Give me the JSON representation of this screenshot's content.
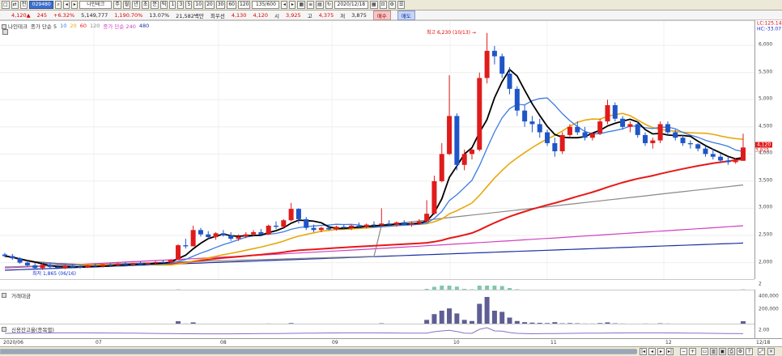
{
  "toolbar": {
    "buttons": [
      "□",
      "⇄"
    ],
    "market_select": "전",
    "code": "029480",
    "name": "나인테크",
    "period_buttons": [
      "주",
      "월",
      "년",
      "초",
      "분",
      "틱"
    ],
    "minute_buttons": [
      "1",
      "3",
      "5",
      "10",
      "20",
      "30",
      "60",
      "120"
    ],
    "count_value": "135/600",
    "date": "2020/12/18"
  },
  "info": {
    "price": "4,120",
    "price_arrow": "▲",
    "change": "245",
    "change_pct": "+6.32%",
    "volume": "5,149,777",
    "volume_ratio": "1,190.70%",
    "turnover": "13.07%",
    "amount": "21,582백만",
    "prev_label": "최우선",
    "bid": "4,130",
    "ask": "4,120",
    "open_label": "시",
    "open": "3,925",
    "high_label": "고",
    "high": "4,375",
    "low_label": "저",
    "low": "3,875",
    "buy_label": "매수",
    "sell_label": "매도"
  },
  "price_panel": {
    "legend": [
      {
        "label": "나인테크",
        "color": "#333333"
      },
      {
        "label": "종가 단순 5",
        "color": "#333333"
      },
      {
        "label": "10",
        "color": "#3a7be0"
      },
      {
        "label": "20",
        "color": "#e8a80c"
      },
      {
        "label": "60",
        "color": "#e81818"
      },
      {
        "label": "120",
        "color": "#888888"
      },
      {
        "label": "종가 단순 240",
        "color": "#d040c0"
      },
      {
        "label": "480",
        "color": "#1a2fa0"
      }
    ],
    "top_right": {
      "lc": "LC:125.14",
      "hc": "HC:-33.07"
    },
    "high_annotation": "최고 6,230 (10/13) →",
    "low_annotation": "최저 1,865 (06/16)",
    "last_price_tag": "4,120",
    "last_price_tag2": "3,925",
    "y_ticks": [
      "6,000",
      "5,500",
      "5,000",
      "4,500",
      "4,000",
      "3,500",
      "3,000",
      "2,500",
      "2,000"
    ],
    "bottom_right": "2"
  },
  "volume_panel": {
    "label": "거래대금",
    "y_ticks": [
      "400,000",
      "200,000"
    ]
  },
  "credit_panel": {
    "label": "신용잔고율(종목별)",
    "y_ticks": [
      "2.00"
    ]
  },
  "x_axis": {
    "labels": [
      "2020/06",
      "07",
      "08",
      "09",
      "10",
      "11",
      "12",
      "12/18"
    ]
  },
  "colors": {
    "up": "#e01b1b",
    "down": "#1f55c8",
    "ma5": "#000000",
    "ma10": "#3a7be0",
    "ma20": "#e8a80c",
    "ma60": "#e81818",
    "ma120": "#888888",
    "ma240": "#d040c0",
    "ma480": "#1a2fa0",
    "bar": "#5e5e94",
    "credit": "#8a6fc6"
  },
  "chart_data": {
    "type": "candlestick",
    "title": "나인테크",
    "x_range": [
      "2020/06",
      "2020/12/18"
    ],
    "ylim": [
      1800,
      6300
    ],
    "y_ticks": [
      2000,
      2500,
      3000,
      3500,
      4000,
      4500,
      5000,
      5500,
      6000
    ],
    "candles_ohlc": [
      [
        2150,
        2180,
        2100,
        2120
      ],
      [
        2120,
        2160,
        2050,
        2080
      ],
      [
        2080,
        2100,
        1980,
        2000
      ],
      [
        2000,
        2050,
        1920,
        1950
      ],
      [
        1950,
        2000,
        1880,
        1900
      ],
      [
        1900,
        1990,
        1865,
        1960
      ],
      [
        1960,
        1990,
        1900,
        1920
      ],
      [
        1920,
        1960,
        1880,
        1900
      ],
      [
        1900,
        1960,
        1880,
        1940
      ],
      [
        1940,
        1970,
        1900,
        1920
      ],
      [
        1920,
        1950,
        1890,
        1910
      ],
      [
        1910,
        1960,
        1900,
        1950
      ],
      [
        1950,
        1980,
        1920,
        1930
      ],
      [
        1930,
        1970,
        1910,
        1960
      ],
      [
        1960,
        1990,
        1930,
        1950
      ],
      [
        1950,
        1990,
        1940,
        1980
      ],
      [
        1980,
        2010,
        1950,
        1960
      ],
      [
        1960,
        2000,
        1940,
        1990
      ],
      [
        1990,
        2020,
        1960,
        1970
      ],
      [
        1970,
        2000,
        1950,
        1990
      ],
      [
        1990,
        2030,
        1970,
        2010
      ],
      [
        2010,
        2040,
        1990,
        2000
      ],
      [
        2000,
        2060,
        1990,
        2050
      ],
      [
        2050,
        2340,
        2050,
        2320
      ],
      [
        2320,
        2440,
        2260,
        2300
      ],
      [
        2300,
        2680,
        2300,
        2600
      ],
      [
        2600,
        2640,
        2480,
        2520
      ],
      [
        2520,
        2580,
        2440,
        2470
      ],
      [
        2470,
        2560,
        2420,
        2540
      ],
      [
        2540,
        2600,
        2480,
        2500
      ],
      [
        2500,
        2560,
        2400,
        2440
      ],
      [
        2440,
        2520,
        2400,
        2480
      ],
      [
        2480,
        2560,
        2450,
        2520
      ],
      [
        2520,
        2600,
        2480,
        2560
      ],
      [
        2560,
        2620,
        2500,
        2520
      ],
      [
        2520,
        2700,
        2510,
        2680
      ],
      [
        2680,
        2760,
        2620,
        2660
      ],
      [
        2660,
        2800,
        2640,
        2780
      ],
      [
        2780,
        3100,
        2760,
        2990
      ],
      [
        2990,
        3000,
        2720,
        2800
      ],
      [
        2800,
        2840,
        2600,
        2640
      ],
      [
        2640,
        2700,
        2560,
        2600
      ],
      [
        2600,
        2660,
        2560,
        2640
      ],
      [
        2640,
        2700,
        2600,
        2610
      ],
      [
        2610,
        2680,
        2590,
        2660
      ],
      [
        2660,
        2700,
        2620,
        2640
      ],
      [
        2640,
        2700,
        2600,
        2680
      ],
      [
        2680,
        2740,
        2640,
        2660
      ],
      [
        2660,
        2720,
        2630,
        2700
      ],
      [
        2700,
        2760,
        2660,
        2690
      ],
      [
        2690,
        3000,
        2670,
        2720
      ],
      [
        2720,
        2780,
        2680,
        2700
      ],
      [
        2700,
        2760,
        2660,
        2740
      ],
      [
        2740,
        2780,
        2690,
        2700
      ],
      [
        2700,
        2760,
        2660,
        2720
      ],
      [
        2720,
        2800,
        2700,
        2760
      ],
      [
        2760,
        3150,
        2740,
        2900
      ],
      [
        2900,
        3600,
        2880,
        3500
      ],
      [
        3500,
        4200,
        3480,
        4000
      ],
      [
        4000,
        5450,
        3980,
        4700
      ],
      [
        4700,
        4750,
        3700,
        3800
      ],
      [
        3800,
        4080,
        3700,
        4000
      ],
      [
        4000,
        4100,
        3900,
        4080
      ],
      [
        4080,
        5500,
        4050,
        5400
      ],
      [
        5400,
        6230,
        5300,
        5900
      ],
      [
        5900,
        5990,
        5650,
        5800
      ],
      [
        5800,
        5850,
        5400,
        5480
      ],
      [
        5480,
        5600,
        5100,
        5200
      ],
      [
        5200,
        5250,
        4700,
        4800
      ],
      [
        4800,
        4900,
        4500,
        4600
      ],
      [
        4600,
        4700,
        4400,
        4550
      ],
      [
        4550,
        4650,
        4300,
        4400
      ],
      [
        4400,
        4450,
        4150,
        4200
      ],
      [
        4200,
        4300,
        3950,
        4050
      ],
      [
        4050,
        4400,
        4000,
        4350
      ],
      [
        4350,
        4550,
        4300,
        4500
      ],
      [
        4500,
        4600,
        4350,
        4400
      ],
      [
        4400,
        4500,
        4250,
        4300
      ],
      [
        4300,
        4400,
        4250,
        4380
      ],
      [
        4380,
        4650,
        4350,
        4600
      ],
      [
        4600,
        5000,
        4550,
        4900
      ],
      [
        4900,
        4950,
        4600,
        4650
      ],
      [
        4650,
        4700,
        4450,
        4500
      ],
      [
        4500,
        4600,
        4400,
        4550
      ],
      [
        4550,
        4600,
        4300,
        4350
      ],
      [
        4350,
        4400,
        4150,
        4200
      ],
      [
        4200,
        4300,
        4100,
        4250
      ],
      [
        4250,
        4600,
        4200,
        4550
      ],
      [
        4550,
        4600,
        4350,
        4400
      ],
      [
        4400,
        4450,
        4250,
        4300
      ],
      [
        4300,
        4350,
        4150,
        4200
      ],
      [
        4200,
        4250,
        4100,
        4180
      ],
      [
        4180,
        4200,
        4050,
        4100
      ],
      [
        4100,
        4150,
        3950,
        4000
      ],
      [
        4000,
        4100,
        3900,
        3950
      ],
      [
        3950,
        4000,
        3850,
        3880
      ],
      [
        3880,
        3950,
        3800,
        3850
      ],
      [
        3850,
        3920,
        3820,
        3875
      ],
      [
        3875,
        4375,
        3875,
        4120
      ]
    ],
    "volume": [
      2,
      1,
      1,
      1,
      1,
      1,
      1,
      1,
      1,
      1,
      1,
      1,
      1,
      1,
      1,
      1,
      1,
      1,
      1,
      1,
      1,
      1,
      1,
      14,
      4,
      9,
      2,
      2,
      2,
      2,
      2,
      2,
      2,
      3,
      2,
      4,
      2,
      3,
      6,
      2,
      2,
      2,
      1,
      1,
      1,
      1,
      1,
      1,
      1,
      1,
      5,
      1,
      1,
      1,
      1,
      2,
      20,
      45,
      60,
      70,
      48,
      20,
      15,
      90,
      120,
      60,
      55,
      30,
      15,
      10,
      8,
      7,
      6,
      10,
      5,
      6,
      5,
      4,
      4,
      6,
      9,
      5,
      4,
      3,
      3,
      4,
      3,
      5,
      4,
      3,
      3,
      2,
      2,
      3,
      2,
      2,
      2,
      2,
      14
    ]
  }
}
